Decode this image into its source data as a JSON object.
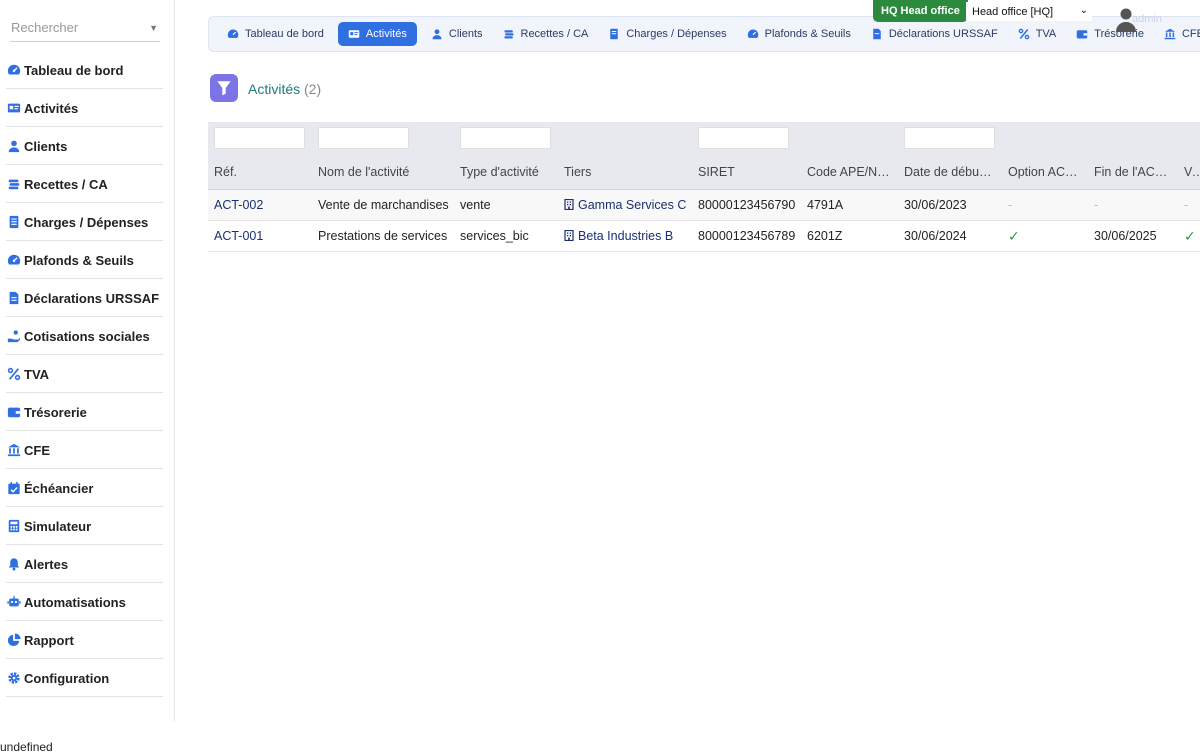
{
  "sidebar": {
    "search_placeholder": "Rechercher",
    "items": [
      {
        "label": "Tableau de bord",
        "icon": "gauge-icon"
      },
      {
        "label": "Activités",
        "icon": "id-card-icon"
      },
      {
        "label": "Clients",
        "icon": "user-icon"
      },
      {
        "label": "Recettes / CA",
        "icon": "coins-icon"
      },
      {
        "label": "Charges / Dépenses",
        "icon": "document-icon"
      },
      {
        "label": "Plafonds & Seuils",
        "icon": "gauge-icon"
      },
      {
        "label": "Déclarations URSSAF",
        "icon": "file-icon"
      },
      {
        "label": "Cotisations sociales",
        "icon": "hand-coin-icon"
      },
      {
        "label": "TVA",
        "icon": "percent-icon"
      },
      {
        "label": "Trésorerie",
        "icon": "wallet-icon"
      },
      {
        "label": "CFE",
        "icon": "bank-icon"
      },
      {
        "label": "Échéancier",
        "icon": "calendar-check-icon"
      },
      {
        "label": "Simulateur",
        "icon": "calculator-icon"
      },
      {
        "label": "Alertes",
        "icon": "bell-icon"
      },
      {
        "label": "Automatisations",
        "icon": "robot-icon"
      },
      {
        "label": "Rapport",
        "icon": "pie-chart-icon"
      },
      {
        "label": "Configuration",
        "icon": "gear-icon"
      }
    ]
  },
  "topbar": {
    "tabs": [
      {
        "label": "Tableau de bord",
        "icon": "gauge-icon",
        "active": false
      },
      {
        "label": "Activités",
        "icon": "id-card-icon",
        "active": true
      },
      {
        "label": "Clients",
        "icon": "user-icon",
        "active": false
      },
      {
        "label": "Recettes / CA",
        "icon": "coins-icon",
        "active": false
      },
      {
        "label": "Charges / Dépenses",
        "icon": "document-icon",
        "active": false
      },
      {
        "label": "Plafonds & Seuils",
        "icon": "gauge-icon",
        "active": false
      },
      {
        "label": "Déclarations URSSAF",
        "icon": "file-icon",
        "active": false
      },
      {
        "label": "TVA",
        "icon": "percent-icon",
        "active": false
      },
      {
        "label": "Trésorerie",
        "icon": "wallet-icon",
        "active": false
      },
      {
        "label": "CFE",
        "icon": "bank-icon",
        "active": false
      }
    ],
    "hq_badge": "HQ Head office",
    "office_select": "Head office [HQ]",
    "user_name": "admin"
  },
  "page": {
    "title": "Activités",
    "count": "(2)"
  },
  "table": {
    "headers": [
      "Réf.",
      "Nom de l'activité",
      "Type d'activité",
      "Tiers",
      "SIRET",
      "Code APE/N…",
      "Date de débu…",
      "Option ACRE",
      "Fin de l'ACRE",
      "Ver"
    ],
    "rows": [
      {
        "ref": "ACT-002",
        "nom": "Vente de marchandises",
        "type": "vente",
        "tiers": "Gamma Services C",
        "siret": "80000123456790",
        "ape": "4791A",
        "date_debut": "30/06/2023",
        "acre": "-",
        "fin_acre": "-",
        "ver": "-"
      },
      {
        "ref": "ACT-001",
        "nom": "Prestations de services",
        "type": "services_bic",
        "tiers": "Beta Industries B",
        "siret": "80000123456789",
        "ape": "6201Z",
        "date_debut": "30/06/2024",
        "acre": "✓",
        "fin_acre": "30/06/2025",
        "ver": "✓"
      }
    ]
  },
  "footer": "undefined",
  "colors": {
    "accent": "#2f6fe0",
    "hq_badge": "#2b8a3e",
    "title": "#1d7a7a",
    "title_icon": "#7b73e6",
    "check": "#2b9a45"
  }
}
